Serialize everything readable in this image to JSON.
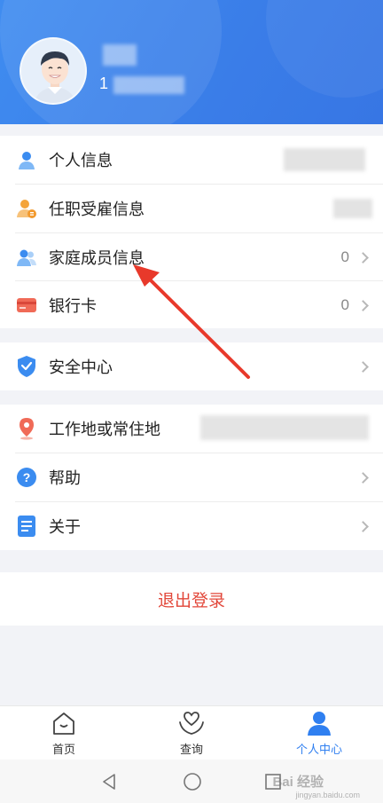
{
  "user": {
    "id_prefix": "1"
  },
  "profile_section": [
    {
      "label": "个人信息",
      "value": "",
      "icon": "person-icon"
    },
    {
      "label": "任职受雇信息",
      "value": "",
      "icon": "employment-icon"
    },
    {
      "label": "家庭成员信息",
      "value": "0",
      "icon": "family-icon"
    },
    {
      "label": "银行卡",
      "value": "0",
      "icon": "bank-card-icon"
    }
  ],
  "security_section": [
    {
      "label": "安全中心",
      "value": "",
      "icon": "shield-icon"
    }
  ],
  "misc_section": [
    {
      "label": "工作地或常住地",
      "value": "",
      "icon": "location-pin-icon"
    },
    {
      "label": "帮助",
      "value": "",
      "icon": "help-icon"
    },
    {
      "label": "关于",
      "value": "",
      "icon": "document-icon"
    }
  ],
  "logout_label": "退出登录",
  "tabbar": [
    {
      "label": "首页",
      "icon": "home-icon",
      "active": false
    },
    {
      "label": "查询",
      "icon": "heart-hands-icon",
      "active": false
    },
    {
      "label": "个人中心",
      "icon": "user-center-icon",
      "active": true
    }
  ],
  "watermark": {
    "text": "Bai 经验",
    "sub": "jingyan.baidu.com"
  },
  "colors": {
    "primary": "#3a7de8",
    "logout": "#e2473a",
    "accent_arrow": "#e8392b"
  }
}
